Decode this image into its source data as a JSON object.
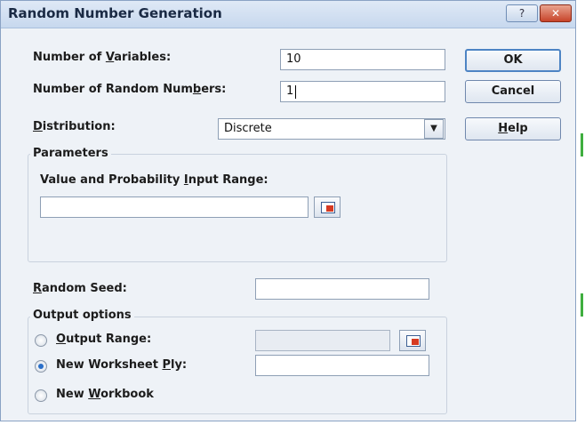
{
  "dialog": {
    "title": "Random Number Generation",
    "help_glyph": "?",
    "close_glyph": "✕"
  },
  "fields": {
    "num_variables": {
      "label_pre": "Number of ",
      "label_ul": "V",
      "label_post": "ariables:",
      "value": "10"
    },
    "num_random_numbers": {
      "label_pre": "Number of Random Num",
      "label_ul": "b",
      "label_post": "ers:",
      "value": "1"
    },
    "distribution": {
      "label_pre": "",
      "label_ul": "D",
      "label_post": "istribution:",
      "value": "Discrete"
    }
  },
  "buttons": {
    "ok": "OK",
    "cancel": "Cancel",
    "help_ul": "H",
    "help_post": "elp"
  },
  "parameters": {
    "group_title": "Parameters",
    "input_range_label_pre": "Value and Probability ",
    "input_range_label_ul": "I",
    "input_range_label_post": "nput Range:",
    "input_range_value": ""
  },
  "random_seed": {
    "label_ul": "R",
    "label_post": "andom Seed:",
    "value": ""
  },
  "output_options": {
    "group_title": "Output options",
    "output_range": {
      "label_ul": "O",
      "label_post": "utput Range:",
      "value": "",
      "selected": false
    },
    "new_worksheet_ply": {
      "label_pre": "New Worksheet ",
      "label_ul": "P",
      "label_post": "ly:",
      "value": "",
      "selected": true
    },
    "new_workbook": {
      "label_pre": "New ",
      "label_ul": "W",
      "label_post": "orkbook",
      "selected": false
    }
  }
}
